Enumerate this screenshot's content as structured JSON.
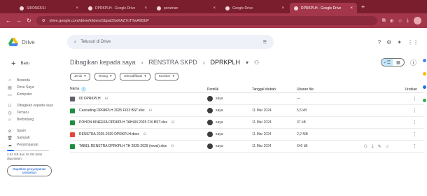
{
  "browser": {
    "tabs": [
      {
        "label": "SIKONEKSI",
        "active": false
      },
      {
        "label": "DPRKPLH - Google Drive",
        "active": false
      },
      {
        "label": "perizinan",
        "active": false
      },
      {
        "label": "Google Drive",
        "active": false
      },
      {
        "label": "DPRKPLH - Google Drive",
        "active": true
      }
    ],
    "url": "drive.google.com/drive/folders/1bpaDSxKAZ7oTTwA9DbP"
  },
  "drive": {
    "logo_text": "Drive",
    "search_placeholder": "Telusuri di Drive"
  },
  "sidebar": {
    "new_label": "Baru",
    "items": [
      {
        "icon": "home-icon",
        "glyph": "⌂",
        "label": "Beranda"
      },
      {
        "icon": "my-drive-icon",
        "glyph": "▤",
        "label": "Drive Saya"
      },
      {
        "icon": "computers-icon",
        "glyph": "▭",
        "label": "Komputer"
      },
      {
        "icon": "shared-icon",
        "glyph": "⚇",
        "label": "Dibagikan kepada saya"
      },
      {
        "icon": "recent-icon",
        "glyph": "◷",
        "label": "Terbaru"
      },
      {
        "icon": "star-icon",
        "glyph": "☆",
        "label": "Berbintang"
      },
      {
        "icon": "spam-icon",
        "glyph": "⊘",
        "label": "Spam"
      },
      {
        "icon": "trash-icon",
        "glyph": "🗑",
        "label": "Sampah"
      },
      {
        "icon": "cloud-icon",
        "glyph": "☁",
        "label": "Penyimpanan"
      }
    ],
    "storage_text": "2,52 GB dari 15 GB telah digunakan",
    "storage_fraction": 0.17,
    "buy_label": "Dapatkan penyimpanan tambahan"
  },
  "main": {
    "breadcrumb": [
      "Dibagikan kepada saya",
      "RENSTRA SKPD",
      "DPRKPLH"
    ],
    "filters": [
      "Jenis",
      "Orang",
      "Dimodifikasi",
      "Sumber"
    ],
    "columns": [
      "Nama",
      "Pemilik",
      "Tanggal diubah",
      "Ukuran file",
      "Urutkan"
    ],
    "rows": [
      {
        "name": "00 DPRKPLH",
        "type": "folder",
        "owner": "saya",
        "modified": "",
        "size": "—"
      },
      {
        "name": "Cascading DPRKPLH 2025 FIX3 BST.xlsx",
        "type": "sheet",
        "owner": "saya",
        "modified": "11 Mar 2024",
        "size": "5,5 kB"
      },
      {
        "name": "POHON KINERJA DPRKPLH TAHUN 2025 FIX BST.xlsx",
        "type": "sheet",
        "owner": "saya",
        "modified": "11 Mar 2024",
        "size": "37 kB"
      },
      {
        "name": "RENSTRA 2025-2029 DPRKPLH.docx",
        "type": "doc",
        "owner": "saya",
        "modified": "11 Mar 2024",
        "size": "2,2 MB"
      },
      {
        "name": "TABEL RENSTRA DPRKPLH TH 2025-2029 (revisi).xlsx",
        "type": "sheet",
        "owner": "saya",
        "modified": "11 Mar 2024",
        "size": "640 kB"
      }
    ]
  },
  "colors": {
    "tabbar": "#7a1e2e",
    "addressbar": "#a3364a",
    "folder": "#5f6368",
    "sheet": "#1e8e3e",
    "doc": "#e8453c",
    "accent": "#0b57d0"
  }
}
